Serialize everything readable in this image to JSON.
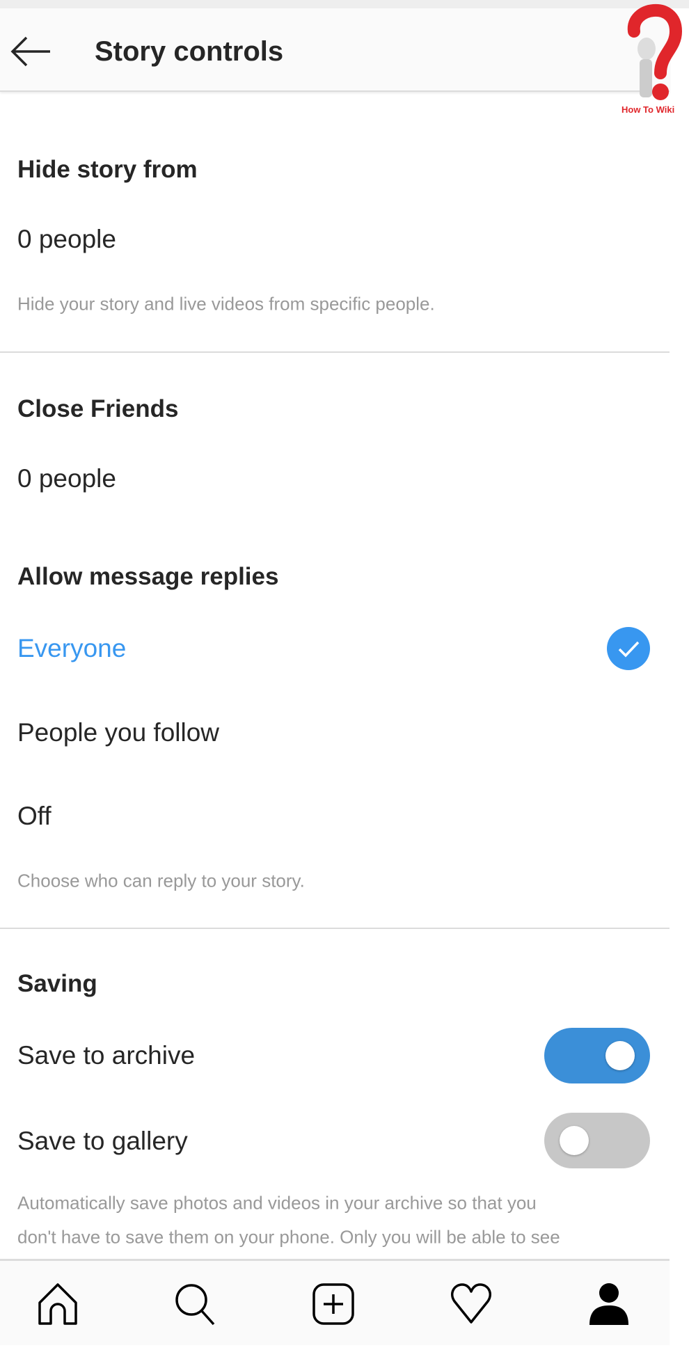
{
  "header": {
    "title": "Story controls",
    "back_icon": "arrow-left-icon"
  },
  "watermark": {
    "text": "How To Wiki"
  },
  "hide_story": {
    "heading": "Hide story from",
    "value": "0 people",
    "caption": "Hide your story and live videos from specific people."
  },
  "close_friends": {
    "heading": "Close Friends",
    "value": "0 people"
  },
  "message_replies": {
    "heading": "Allow message replies",
    "options": [
      {
        "label": "Everyone",
        "selected": true
      },
      {
        "label": "People you follow",
        "selected": false
      },
      {
        "label": "Off",
        "selected": false
      }
    ],
    "caption": "Choose who can reply to your story.",
    "accent": "#3897f0"
  },
  "saving": {
    "heading": "Saving",
    "items": [
      {
        "label": "Save to archive",
        "on": true
      },
      {
        "label": "Save to gallery",
        "on": false
      }
    ],
    "caption_lines": [
      "Automatically save photos and videos in your archive so that you",
      "don't have to save them on your phone. Only you will be able to see"
    ]
  },
  "nav": {
    "icons": [
      "home-icon",
      "search-icon",
      "new-post-icon",
      "heart-icon",
      "profile-icon"
    ]
  }
}
